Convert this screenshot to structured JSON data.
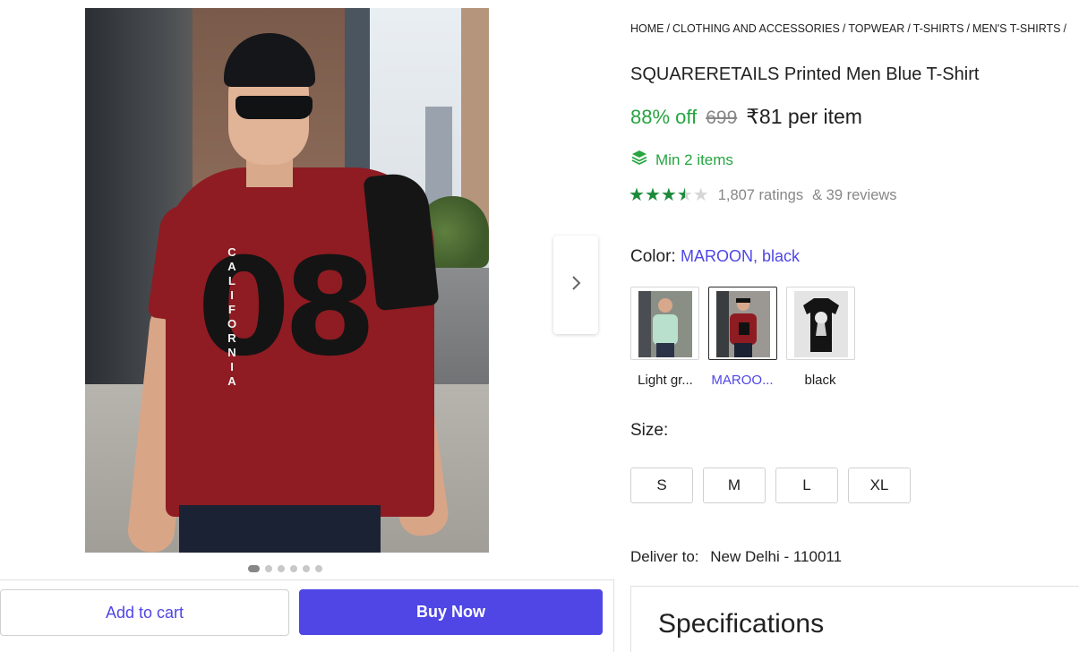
{
  "breadcrumb": [
    "HOME",
    "CLOTHING AND ACCESSORIES",
    "TOPWEAR",
    "T-SHIRTS",
    "MEN'S T-SHIRTS"
  ],
  "product": {
    "title": "SQUARERETAILS Printed Men Blue T-Shirt",
    "discount": "88% off",
    "mrp": "699",
    "price": "₹81 per item",
    "min_items": "Min 2 items",
    "rating_value": 3.5,
    "ratings_text": "1,807 ratings",
    "reviews_text": "& 39 reviews",
    "shirt_print_number": "08",
    "shirt_print_text": "CALIFORNIA"
  },
  "color": {
    "label": "Color:",
    "value": "MAROON, black",
    "swatches": [
      {
        "name": "Light gr...",
        "selected": false
      },
      {
        "name": "MAROO...",
        "selected": true
      },
      {
        "name": "black",
        "selected": false
      }
    ]
  },
  "size": {
    "label": "Size:",
    "options": [
      "S",
      "M",
      "L",
      "XL"
    ]
  },
  "delivery": {
    "label": "Deliver to:",
    "location": "New Delhi - 110011"
  },
  "specifications": {
    "title": "Specifications"
  },
  "actions": {
    "add_to_cart": "Add to cart",
    "buy_now": "Buy Now"
  },
  "gallery": {
    "dot_count": 6,
    "active_dot": 0
  },
  "colors": {
    "accent": "#4f46e5",
    "green": "#26a541",
    "shirt": "#8e1c22"
  }
}
